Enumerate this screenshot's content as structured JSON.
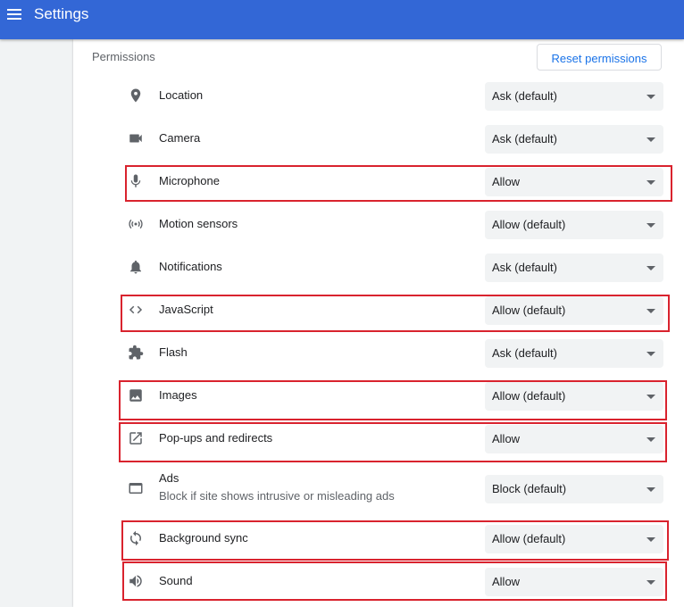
{
  "header": {
    "title": "Settings",
    "menu_icon": "hamburger-menu-icon",
    "background": "#3367d6"
  },
  "permissions": {
    "section_title": "Permissions",
    "reset_button": "Reset permissions",
    "highlight_color": "#d9232e",
    "items": [
      {
        "label": "Location",
        "value": "Ask (default)",
        "icon": "location-pin-icon",
        "highlighted": false
      },
      {
        "label": "Camera",
        "value": "Ask (default)",
        "icon": "camera-icon",
        "highlighted": false
      },
      {
        "label": "Microphone",
        "value": "Allow",
        "icon": "microphone-icon",
        "highlighted": true
      },
      {
        "label": "Motion sensors",
        "value": "Allow (default)",
        "icon": "motion-sensors-icon",
        "highlighted": false
      },
      {
        "label": "Notifications",
        "value": "Ask (default)",
        "icon": "bell-icon",
        "highlighted": false
      },
      {
        "label": "JavaScript",
        "value": "Allow (default)",
        "icon": "code-icon",
        "highlighted": true
      },
      {
        "label": "Flash",
        "value": "Ask (default)",
        "icon": "puzzle-icon",
        "highlighted": false
      },
      {
        "label": "Images",
        "value": "Allow (default)",
        "icon": "image-icon",
        "highlighted": true
      },
      {
        "label": "Pop-ups and redirects",
        "value": "Allow",
        "icon": "open-in-new-icon",
        "highlighted": true
      },
      {
        "label": "Ads",
        "sublabel": "Block if site shows intrusive or misleading ads",
        "value": "Block (default)",
        "icon": "ads-window-icon",
        "highlighted": false
      },
      {
        "label": "Background sync",
        "value": "Allow (default)",
        "icon": "sync-icon",
        "highlighted": true
      },
      {
        "label": "Sound",
        "value": "Allow",
        "icon": "speaker-icon",
        "highlighted": true
      }
    ]
  }
}
